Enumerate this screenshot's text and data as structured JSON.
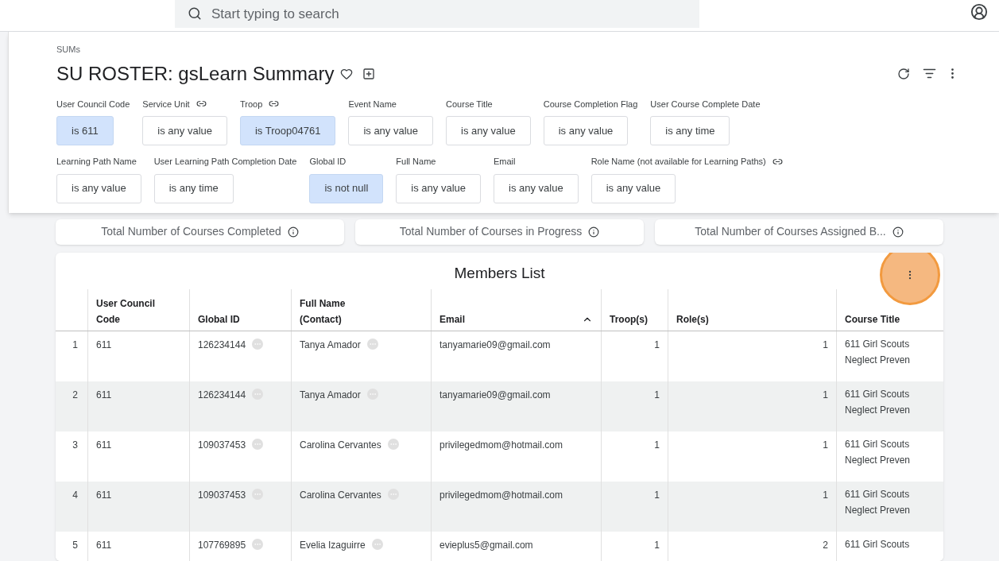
{
  "search": {
    "placeholder": "Start typing to search"
  },
  "breadcrumb": "SUMs",
  "title": "SU ROSTER: gsLearn Summary",
  "filter_rows": [
    [
      {
        "label": "User Council Code",
        "link": false,
        "value": "is 611",
        "selected": true
      },
      {
        "label": "Service Unit",
        "link": true,
        "value": "is any value",
        "selected": false
      },
      {
        "label": "Troop",
        "link": true,
        "value": "is Troop04761",
        "selected": true
      },
      {
        "label": "Event Name",
        "link": false,
        "value": "is any value",
        "selected": false
      },
      {
        "label": "Course Title",
        "link": false,
        "value": "is any value",
        "selected": false
      },
      {
        "label": "Course Completion Flag",
        "link": false,
        "value": "is any value",
        "selected": false
      },
      {
        "label": "User Course Complete Date",
        "link": false,
        "value": "is any time",
        "selected": false
      }
    ],
    [
      {
        "label": "Learning Path Name",
        "link": false,
        "value": "is any value",
        "selected": false
      },
      {
        "label": "User Learning Path Completion Date",
        "link": false,
        "value": "is any time",
        "selected": false
      },
      {
        "label": "Global ID",
        "link": false,
        "value": "is not null",
        "selected": true
      },
      {
        "label": "Full Name",
        "link": false,
        "value": "is any value",
        "selected": false
      },
      {
        "label": "Email",
        "link": false,
        "value": "is any value",
        "selected": false
      },
      {
        "label": "Role Name (not available for Learning Paths)",
        "link": true,
        "value": "is any value",
        "selected": false
      }
    ]
  ],
  "tiles": [
    "Total Number of Courses Completed",
    "Total Number of Courses in Progress",
    "Total Number of Courses Assigned B..."
  ],
  "table": {
    "title": "Members List",
    "columns": [
      {
        "label": "User Council Code",
        "sorted": false,
        "kind": "text"
      },
      {
        "label": "Global ID",
        "sorted": false,
        "kind": "text"
      },
      {
        "label": "Full Name (Contact)",
        "sorted": false,
        "kind": "text"
      },
      {
        "label": "Email",
        "sorted": true,
        "kind": "text"
      },
      {
        "label": "Troop(s)",
        "sorted": false,
        "kind": "count"
      },
      {
        "label": "Role(s)",
        "sorted": false,
        "kind": "count"
      },
      {
        "label": "Course Title",
        "sorted": false,
        "kind": "text"
      }
    ],
    "rows": [
      {
        "index": "1",
        "cells": [
          "611",
          "126234144",
          "Tanya Amador",
          "tanyamarie09@gmail.com",
          "1",
          "1",
          [
            "611 Girl Scouts",
            "Neglect Preven"
          ]
        ]
      },
      {
        "index": "2",
        "cells": [
          "611",
          "126234144",
          "Tanya Amador",
          "tanyamarie09@gmail.com",
          "1",
          "1",
          [
            "611 Girl Scouts",
            "Neglect Preven"
          ]
        ]
      },
      {
        "index": "3",
        "cells": [
          "611",
          "109037453",
          "Carolina Cervantes",
          "privilegedmom@hotmail.com",
          "1",
          "1",
          [
            "611 Girl Scouts",
            "Neglect Preven"
          ]
        ]
      },
      {
        "index": "4",
        "cells": [
          "611",
          "109037453",
          "Carolina Cervantes",
          "privilegedmom@hotmail.com",
          "1",
          "1",
          [
            "611 Girl Scouts",
            "Neglect Preven"
          ]
        ]
      },
      {
        "index": "5",
        "cells": [
          "611",
          "107769895",
          "Evelia Izaguirre",
          "evieplus5@gmail.com",
          "1",
          "2",
          [
            "611 Girl Scouts"
          ]
        ]
      }
    ]
  }
}
